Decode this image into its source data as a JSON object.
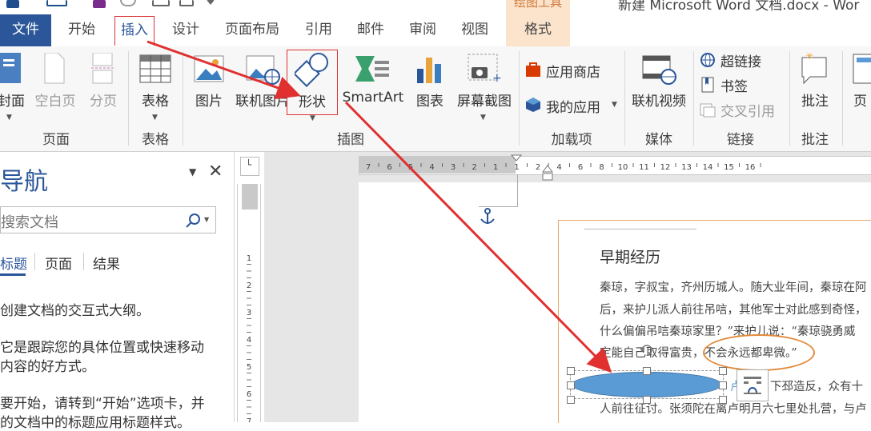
{
  "window": {
    "title": "新建 Microsoft Word 文档.docx - Wor"
  },
  "contextual": {
    "drawing_tools": "绘图工具"
  },
  "tabs": {
    "file": "文件",
    "home": "开始",
    "insert": "插入",
    "design": "设计",
    "layout": "页面布局",
    "references": "引用",
    "mailings": "邮件",
    "review": "审阅",
    "view": "视图",
    "format": "格式"
  },
  "ribbon": {
    "pages": {
      "cover": "封面",
      "blank": "空白页",
      "break": "分页",
      "group": "页面"
    },
    "tables": {
      "table": "表格",
      "group": "表格"
    },
    "illustrations": {
      "picture": "图片",
      "online_picture": "联机图片",
      "shapes": "形状",
      "smartart": "SmartArt",
      "chart": "图表",
      "screenshot": "屏幕截图",
      "group": "插图"
    },
    "addins": {
      "store": "应用商店",
      "my_apps": "我的应用",
      "group": "加载项"
    },
    "media": {
      "online_video": "联机视频",
      "group": "媒体"
    },
    "links": {
      "hyperlink": "超链接",
      "bookmark": "书签",
      "cross_ref": "交叉引用",
      "group": "链接"
    },
    "comments": {
      "comment": "批注",
      "group": "批注"
    },
    "header": {
      "label": "页"
    }
  },
  "nav": {
    "title": "导航",
    "search_placeholder": "搜索文档",
    "tabs": [
      "标题",
      "页面",
      "结果"
    ],
    "body": [
      "创建文档的交互式大纲。",
      "它是跟踪您的具体位置或快速移动",
      "内容的好方式。",
      "要开始，请转到“开始”选项卡，并",
      "的文档中的标题应用标题样式。"
    ]
  },
  "ruler": {
    "h_ticks": [
      "7",
      "6",
      "5",
      "4",
      "3",
      "2",
      "1",
      "1",
      "2",
      "4",
      "6",
      "8",
      "10",
      "11",
      "12",
      "13",
      "14",
      "15",
      "16"
    ],
    "v_ticks": [
      "1",
      "2",
      "3",
      "4",
      "5",
      "6",
      "7"
    ]
  },
  "document": {
    "heading": "早期经历",
    "lines": [
      "秦琼，字叔宝，齐州历城人。随大业年间，秦琼在阿",
      "后，来护儿派人前往吊唁，其他军士对此感到奇怪，",
      "什么偏偏吊唁秦琼家里？”来护儿说：“秦琼骁勇威",
      "定能自己取得富贵，不会永远都卑微。”",
      "下邳造反，众有十",
      "人前往征讨。张须陀在离卢明月六七里处扎营，与卢"
    ],
    "circled_text": "不会永远都卑微。",
    "fragment_right": "卢"
  },
  "colors": {
    "accent": "#2b579a",
    "annotation_red": "#e03030",
    "shape_fill": "#5b9bd5",
    "circle_orange": "#e38a3a"
  }
}
